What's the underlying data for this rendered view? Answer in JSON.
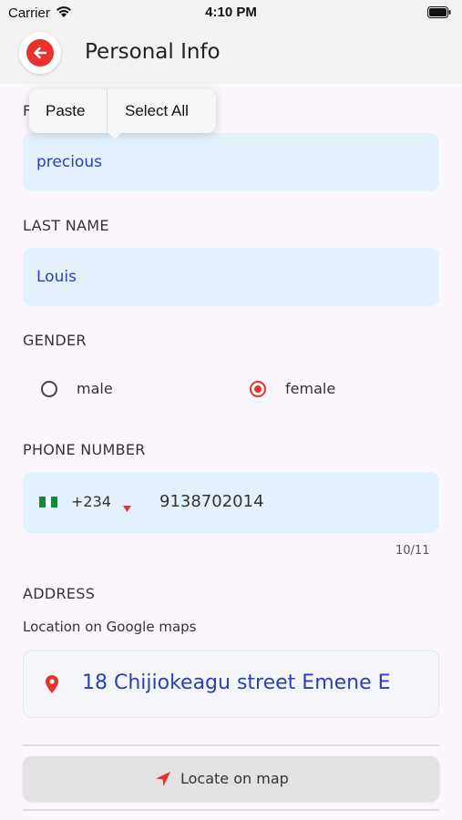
{
  "status_bar": {
    "carrier": "Carrier",
    "time": "4:10 PM"
  },
  "app_bar": {
    "title": "Personal Info"
  },
  "context_menu": {
    "paste": "Paste",
    "select_all": "Select All"
  },
  "first_name": {
    "label_glyph": "F",
    "value": "precious"
  },
  "last_name": {
    "label": "LAST NAME",
    "value": "Louis"
  },
  "gender": {
    "label": "GENDER",
    "options": [
      {
        "label": "male",
        "selected": false
      },
      {
        "label": "female",
        "selected": true
      }
    ]
  },
  "phone": {
    "label": "PHONE NUMBER",
    "country_code": "+234",
    "number": "9138702014",
    "counter": "10/11"
  },
  "address": {
    "label": "ADDRESS",
    "sublabel": "Location on Google maps",
    "value": "18 Chijiokeagu street Emene E"
  },
  "locate_button": {
    "label": "Locate on map"
  },
  "colors": {
    "accent": "#e8322d",
    "field_bg": "#e3f1fd",
    "field_text": "#2b40b5"
  }
}
